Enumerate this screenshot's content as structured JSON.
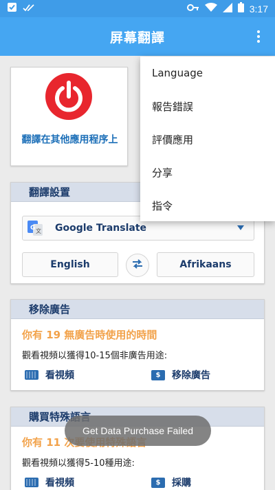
{
  "status_bar": {
    "time": "3:17"
  },
  "app_bar": {
    "title": "屏幕翻譯"
  },
  "power_card": {
    "label": "翻譯在其他應用程序上"
  },
  "settings": {
    "header": "翻譯設置",
    "engine": "Google Translate",
    "source_lang": "English",
    "target_lang": "Afrikaans"
  },
  "ad_card": {
    "header": "移除廣告",
    "highlight": "你有 19 無廣告時使用的時間",
    "desc": "觀看視頻以獲得10-15個非廣告用途:",
    "watch_label": "看視頻",
    "remove_label": "移除廣告"
  },
  "lang_card": {
    "header": "購買特殊語言",
    "highlight": "你有 11 次要使用特殊語言",
    "desc": "觀看視頻以獲得5-10種用途:",
    "watch_label": "看視頻",
    "buy_label": "採購"
  },
  "menu": {
    "items": [
      "Language",
      "報告錯誤",
      "評價應用",
      "分享",
      "指令"
    ]
  },
  "toast": {
    "text": "Get Data Purchase Failed"
  },
  "colors": {
    "app_bar": "#45a6f2",
    "status_bar": "#3f9ce8",
    "power": "#e8262e",
    "accent_text": "#1b3b6b",
    "highlight": "#f2a24a"
  },
  "icons": {
    "status_left": [
      "checkbox-icon",
      "double-check-icon"
    ],
    "status_right": [
      "key-icon",
      "wifi-icon",
      "signal-icon",
      "battery-icon"
    ]
  }
}
